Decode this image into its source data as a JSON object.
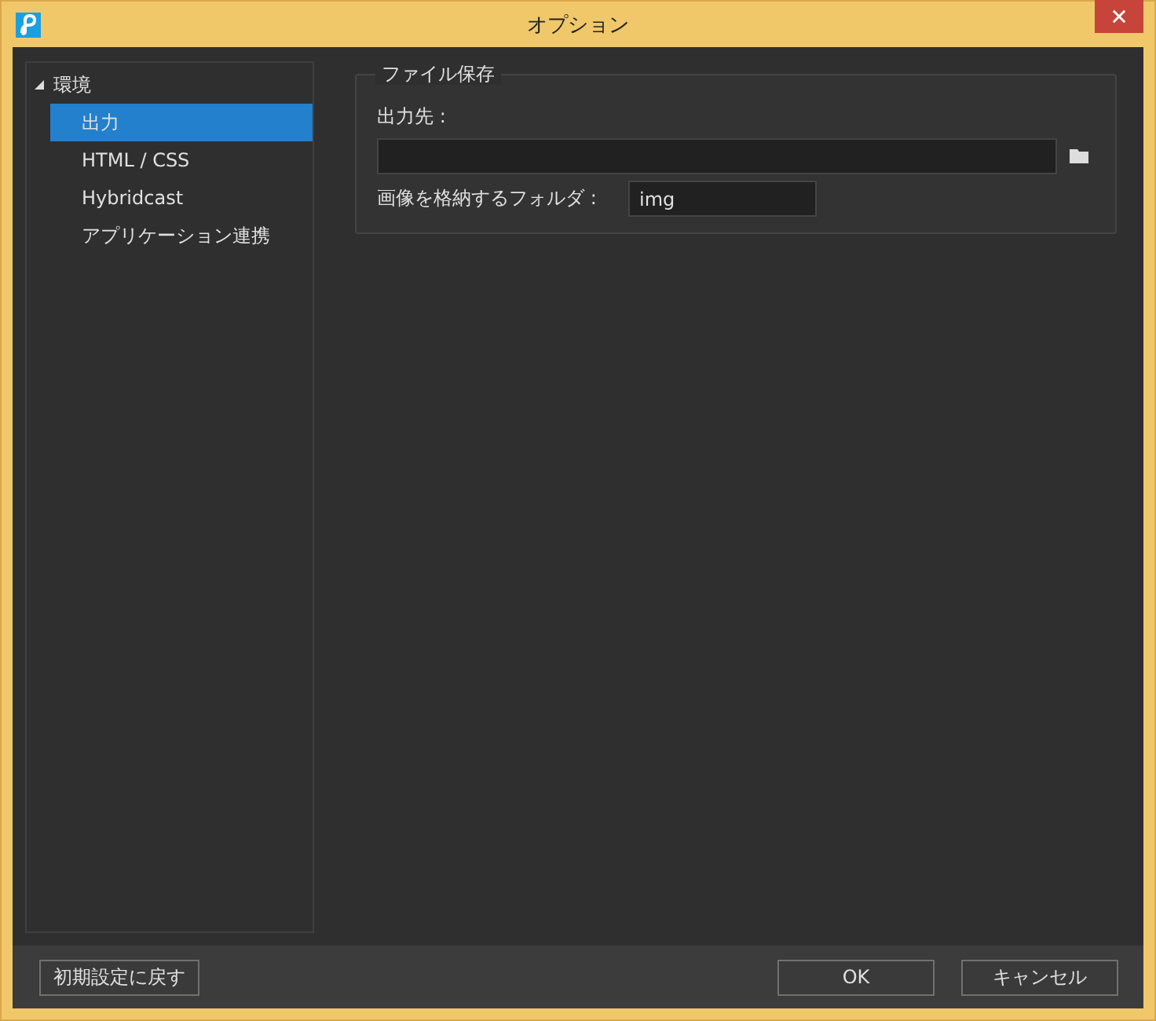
{
  "window": {
    "title": "オプション"
  },
  "sidebar": {
    "items": [
      {
        "label": "環境",
        "expanded": true,
        "selected": false,
        "children": [
          {
            "label": "出力",
            "selected": true
          },
          {
            "label": "HTML / CSS",
            "selected": false
          },
          {
            "label": "Hybridcast",
            "selected": false
          },
          {
            "label": "アプリケーション連携",
            "selected": false
          }
        ]
      }
    ]
  },
  "group": {
    "title": "ファイル保存",
    "output_label": "出力先 :",
    "folder_label": "画像を格納するフォルダ :",
    "folder_value": "img"
  },
  "buttons": {
    "reset": "初期設定に戻す",
    "ok": "OK",
    "cancel": "キャンセル"
  }
}
